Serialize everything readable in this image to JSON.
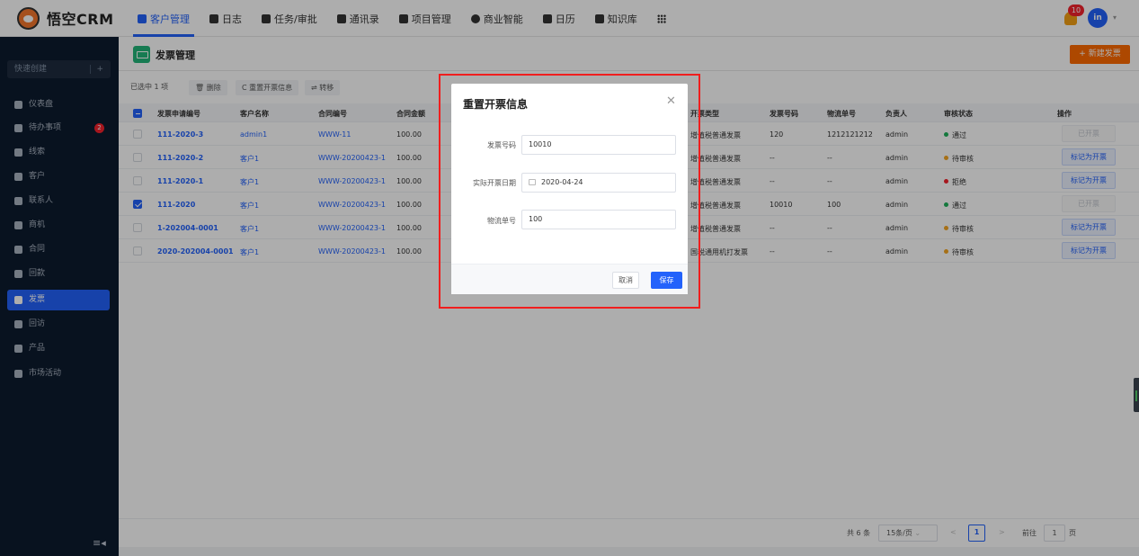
{
  "topbar": {
    "logo_text": "悟空CRM",
    "nav": [
      {
        "label": "客户管理",
        "icon": "customer-icon",
        "active": true
      },
      {
        "label": "日志",
        "icon": "log-icon"
      },
      {
        "label": "任务/审批",
        "icon": "task-icon"
      },
      {
        "label": "通讯录",
        "icon": "contacts-icon"
      },
      {
        "label": "项目管理",
        "icon": "project-icon"
      },
      {
        "label": "商业智能",
        "icon": "bi-icon"
      },
      {
        "label": "日历",
        "icon": "calendar-icon"
      },
      {
        "label": "知识库",
        "icon": "knowledge-icon"
      }
    ],
    "notification_count": "10",
    "avatar_text": "in"
  },
  "sidebar": {
    "quick_create": "快速创建",
    "quick_plus": "+",
    "items": [
      {
        "label": "仪表盘"
      },
      {
        "label": "待办事项",
        "badge": "2"
      },
      {
        "label": "线索"
      },
      {
        "label": "客户"
      },
      {
        "label": "联系人"
      },
      {
        "label": "商机"
      },
      {
        "label": "合同"
      },
      {
        "label": "回款"
      },
      {
        "label": "发票",
        "active": true
      },
      {
        "label": "回访"
      },
      {
        "label": "产品"
      },
      {
        "label": "市场活动"
      }
    ]
  },
  "page": {
    "title": "发票管理",
    "new_button": "+ 新建发票",
    "selected_text": "已选中 1 项",
    "toolbar": {
      "delete": "🗑 删除",
      "reset": "C 重置开票信息",
      "transfer": "⇌ 转移"
    }
  },
  "table": {
    "headers": {
      "apply_no": "发票申请编号",
      "customer": "客户名称",
      "contract": "合同编号",
      "amount": "合同金额",
      "type": "开票类型",
      "invoice_no": "发票号码",
      "logistics": "物流单号",
      "owner": "负责人",
      "status": "审核状态",
      "op": "操作"
    },
    "rows": [
      {
        "apply_no": "111-2020-3",
        "customer": "admin1",
        "contract": "WWW-11",
        "amount": "100.00",
        "type": "增值税普通发票",
        "invoice_no": "120",
        "logistics": "1212121212",
        "owner": "admin",
        "status": "通过",
        "status_color": "#1eb25b",
        "op": "已开票",
        "op_enabled": false,
        "checked": false
      },
      {
        "apply_no": "111-2020-2",
        "customer": "客户1",
        "contract": "WWW-20200423-1",
        "amount": "100.00",
        "type": "增值税普通发票",
        "invoice_no": "--",
        "logistics": "--",
        "owner": "admin",
        "status": "待审核",
        "status_color": "#f5a623",
        "op": "标记为开票",
        "op_enabled": true,
        "checked": false
      },
      {
        "apply_no": "111-2020-1",
        "customer": "客户1",
        "contract": "WWW-20200423-1",
        "amount": "100.00",
        "type": "增值税普通发票",
        "invoice_no": "--",
        "logistics": "--",
        "owner": "admin",
        "status": "拒绝",
        "status_color": "#f5222d",
        "op": "标记为开票",
        "op_enabled": true,
        "checked": false
      },
      {
        "apply_no": "111-2020",
        "customer": "客户1",
        "contract": "WWW-20200423-1",
        "amount": "100.00",
        "type": "增值税普通发票",
        "invoice_no": "10010",
        "logistics": "100",
        "owner": "admin",
        "status": "通过",
        "status_color": "#1eb25b",
        "op": "已开票",
        "op_enabled": false,
        "checked": true
      },
      {
        "apply_no": "1-202004-0001",
        "customer": "客户1",
        "contract": "WWW-20200423-1",
        "amount": "100.00",
        "type": "增值税普通发票",
        "invoice_no": "--",
        "logistics": "--",
        "owner": "admin",
        "status": "待审核",
        "status_color": "#f5a623",
        "op": "标记为开票",
        "op_enabled": true,
        "checked": false
      },
      {
        "apply_no": "2020-202004-0001",
        "customer": "客户1",
        "contract": "WWW-20200423-1",
        "amount": "100.00",
        "type": "国税通用机打发票",
        "invoice_no": "--",
        "logistics": "--",
        "owner": "admin",
        "status": "待审核",
        "status_color": "#f5a623",
        "op": "标记为开票",
        "op_enabled": true,
        "checked": false
      }
    ]
  },
  "pager": {
    "total": "共 6 条",
    "page_size": "15条/页",
    "prev": "<",
    "current": "1",
    "next": ">",
    "goto_prefix": "前往",
    "goto_value": "1",
    "goto_suffix": "页"
  },
  "modal": {
    "title": "重置开票信息",
    "close": "✕",
    "fields": {
      "invoice_no_label": "发票号码",
      "invoice_no_value": "10010",
      "date_label": "实际开票日期",
      "date_value": "2020-04-24",
      "logistics_label": "物流单号",
      "logistics_value": "100"
    },
    "cancel": "取消",
    "save": "保存"
  },
  "colors": {
    "primary": "#2362fb",
    "accent": "#ff6a00",
    "sidebar": "#0d1b2e",
    "highlight": "#f01e1e"
  }
}
